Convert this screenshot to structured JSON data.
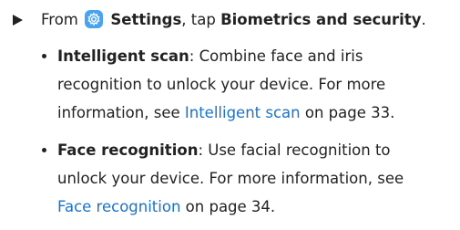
{
  "step": {
    "prefix": "From",
    "settings_label": "Settings",
    "middle": ", tap",
    "target": "Biometrics and security",
    "suffix": ".",
    "icon": "settings-gear-icon",
    "icon_color": "#4aa3f0"
  },
  "bullets": [
    {
      "term": "Intelligent scan",
      "line1": ": Combine face and iris",
      "line2": "recognition to unlock your device. For more",
      "line3_prefix": "information, see",
      "link": "Intelligent scan",
      "line3_suffix": "on page 33."
    },
    {
      "term": "Face recognition",
      "line1": ": Use facial recognition to",
      "line2": "unlock your device. For more information, see",
      "line3_prefix": "",
      "link": "Face recognition",
      "line3_suffix": "on page 34."
    }
  ],
  "colors": {
    "text": "#222222",
    "link": "#1a73c9"
  }
}
